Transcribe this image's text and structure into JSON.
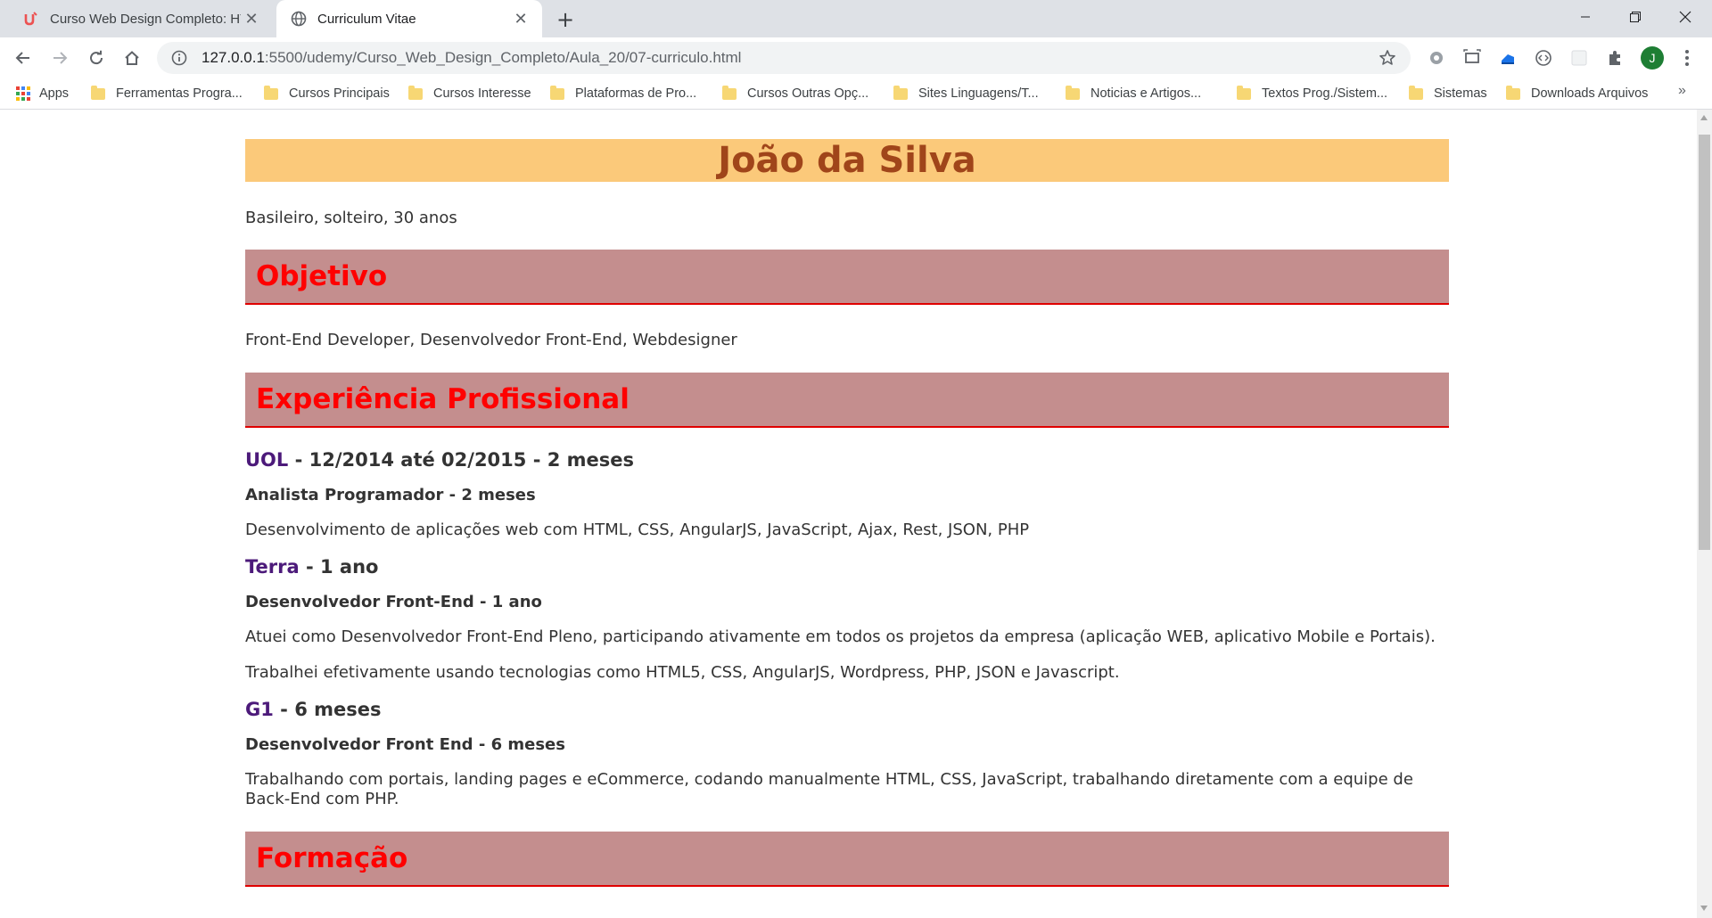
{
  "browser": {
    "tabs": [
      {
        "title": "Curso Web Design Completo: HT",
        "icon": "udemy-logo-icon",
        "active": false
      },
      {
        "title": "Curriculum Vitae",
        "icon": "globe-icon",
        "active": true
      }
    ],
    "address": {
      "host": "127.0.0.1",
      "path": ":5500/udemy/Curso_Web_Design_Completo/Aula_20/07-curriculo.html"
    },
    "profile_initial": "J",
    "bookmarks": [
      "Apps",
      "Ferramentas Progra...",
      "Cursos Principais",
      "Cursos Interesse",
      "Plataformas de Pro...",
      "Cursos Outras Opç...",
      "Sites Linguagens/T...",
      "Noticias e Artigos...",
      "Textos Prog./Sistem...",
      "Sistemas",
      "Downloads Arquivos"
    ],
    "bookmarks_overflow": "»"
  },
  "page": {
    "name": "João da Silva",
    "subline": "Basileiro, solteiro, 30 anos",
    "sections": {
      "objective_title": "Objetivo",
      "objective_text": "Front-End Developer, Desenvolvedor Front-End, Webdesigner",
      "experience_title": "Experiência Profissional",
      "education_title": "Formação"
    },
    "jobs": [
      {
        "company": "UOL",
        "period": " - 12/2014 até 02/2015 - 2 meses",
        "role": "Analista Programador - 2 meses",
        "descriptions": [
          "Desenvolvimento de aplicações web com HTML, CSS, AngularJS, JavaScript, Ajax, Rest, JSON, PHP"
        ]
      },
      {
        "company": "Terra",
        "period": " - 1 ano",
        "role": "Desenvolvedor Front-End - 1 ano",
        "descriptions": [
          "Atuei como Desenvolvedor Front-End Pleno, participando ativamente em todos os projetos da empresa (aplicação WEB, aplicativo Mobile e Portais).",
          "Trabalhei efetivamente usando tecnologias como HTML5, CSS, AngularJS, Wordpress, PHP, JSON e Javascript."
        ]
      },
      {
        "company": "G1",
        "period": " - 6 meses",
        "role": "Desenvolvedor Front End - 6 meses",
        "descriptions": [
          "Trabalhando com portais, landing pages e eCommerce, codando manualmente HTML, CSS, JavaScript, trabalhando diretamente com a equipe de Back-End com PHP."
        ]
      }
    ]
  },
  "colors": {
    "name_banner_bg": "#fbc97a",
    "name_text": "#a0451a",
    "section_bg": "#c48e8e",
    "section_text": "#ff0000",
    "company_link": "#4c1a7a"
  }
}
